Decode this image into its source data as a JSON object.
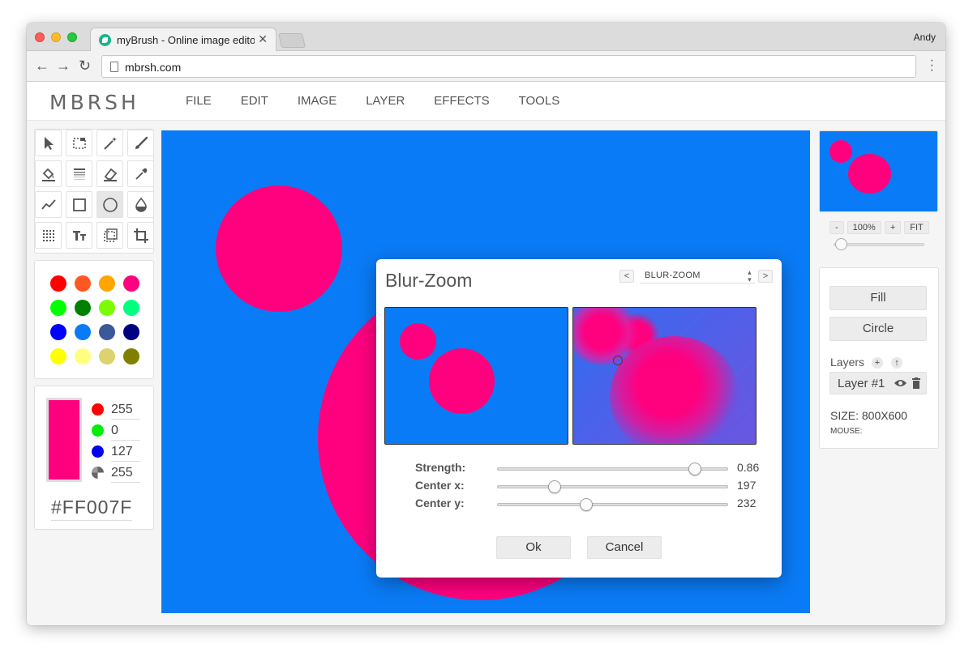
{
  "browser": {
    "tab_title": "myBrush - Online image editor",
    "tab_close": "✕",
    "profile": "Andy",
    "url": "mbrsh.com"
  },
  "app": {
    "logo": "MBRSH",
    "menu": [
      "FILE",
      "EDIT",
      "IMAGE",
      "LAYER",
      "EFFECTS",
      "TOOLS"
    ]
  },
  "tools": [
    "select-arrow",
    "rect-select",
    "magic-wand",
    "brush",
    "paint-bucket",
    "gradient",
    "eraser",
    "eyedropper",
    "line",
    "rectangle",
    "circle",
    "blur-drop",
    "pattern",
    "text",
    "marquee",
    "crop"
  ],
  "palette": [
    "#ff0000",
    "#ff5722",
    "#ffa500",
    "#ff007f",
    "#00ff00",
    "#008000",
    "#7cfc00",
    "#00ff7f",
    "#0000ff",
    "#0a7bf6",
    "#3b5998",
    "#000080",
    "#ffff00",
    "#ffff80",
    "#dcd36e",
    "#808000"
  ],
  "color": {
    "current": "#ff007f",
    "r": "255",
    "g": "0",
    "b": "127",
    "a": "255",
    "hex": "#FF007F"
  },
  "navigator": {
    "minus": "-",
    "zoom": "100%",
    "plus": "+",
    "fit": "FIT"
  },
  "right_panel": {
    "fill_button": "Fill",
    "circle_button": "Circle",
    "layers_label": "Layers",
    "layer_add": "+",
    "layer_up": "↑",
    "layer_name": "Layer #1",
    "size": "SIZE: 800X600",
    "mouse": "MOUSE:"
  },
  "dialog": {
    "title": "Blur-Zoom",
    "prev": "<",
    "next": ">",
    "effect_select": "BLUR-ZOOM",
    "sliders": [
      {
        "label": "Strength:",
        "value": "0.86",
        "fraction": 0.86
      },
      {
        "label": "Center x:",
        "value": "197",
        "fraction": 0.246
      },
      {
        "label": "Center y:",
        "value": "232",
        "fraction": 0.386
      }
    ],
    "ok": "Ok",
    "cancel": "Cancel"
  },
  "colors": {
    "canvas_bg": "#0a7bf6",
    "accent_pink": "#ff007f"
  }
}
